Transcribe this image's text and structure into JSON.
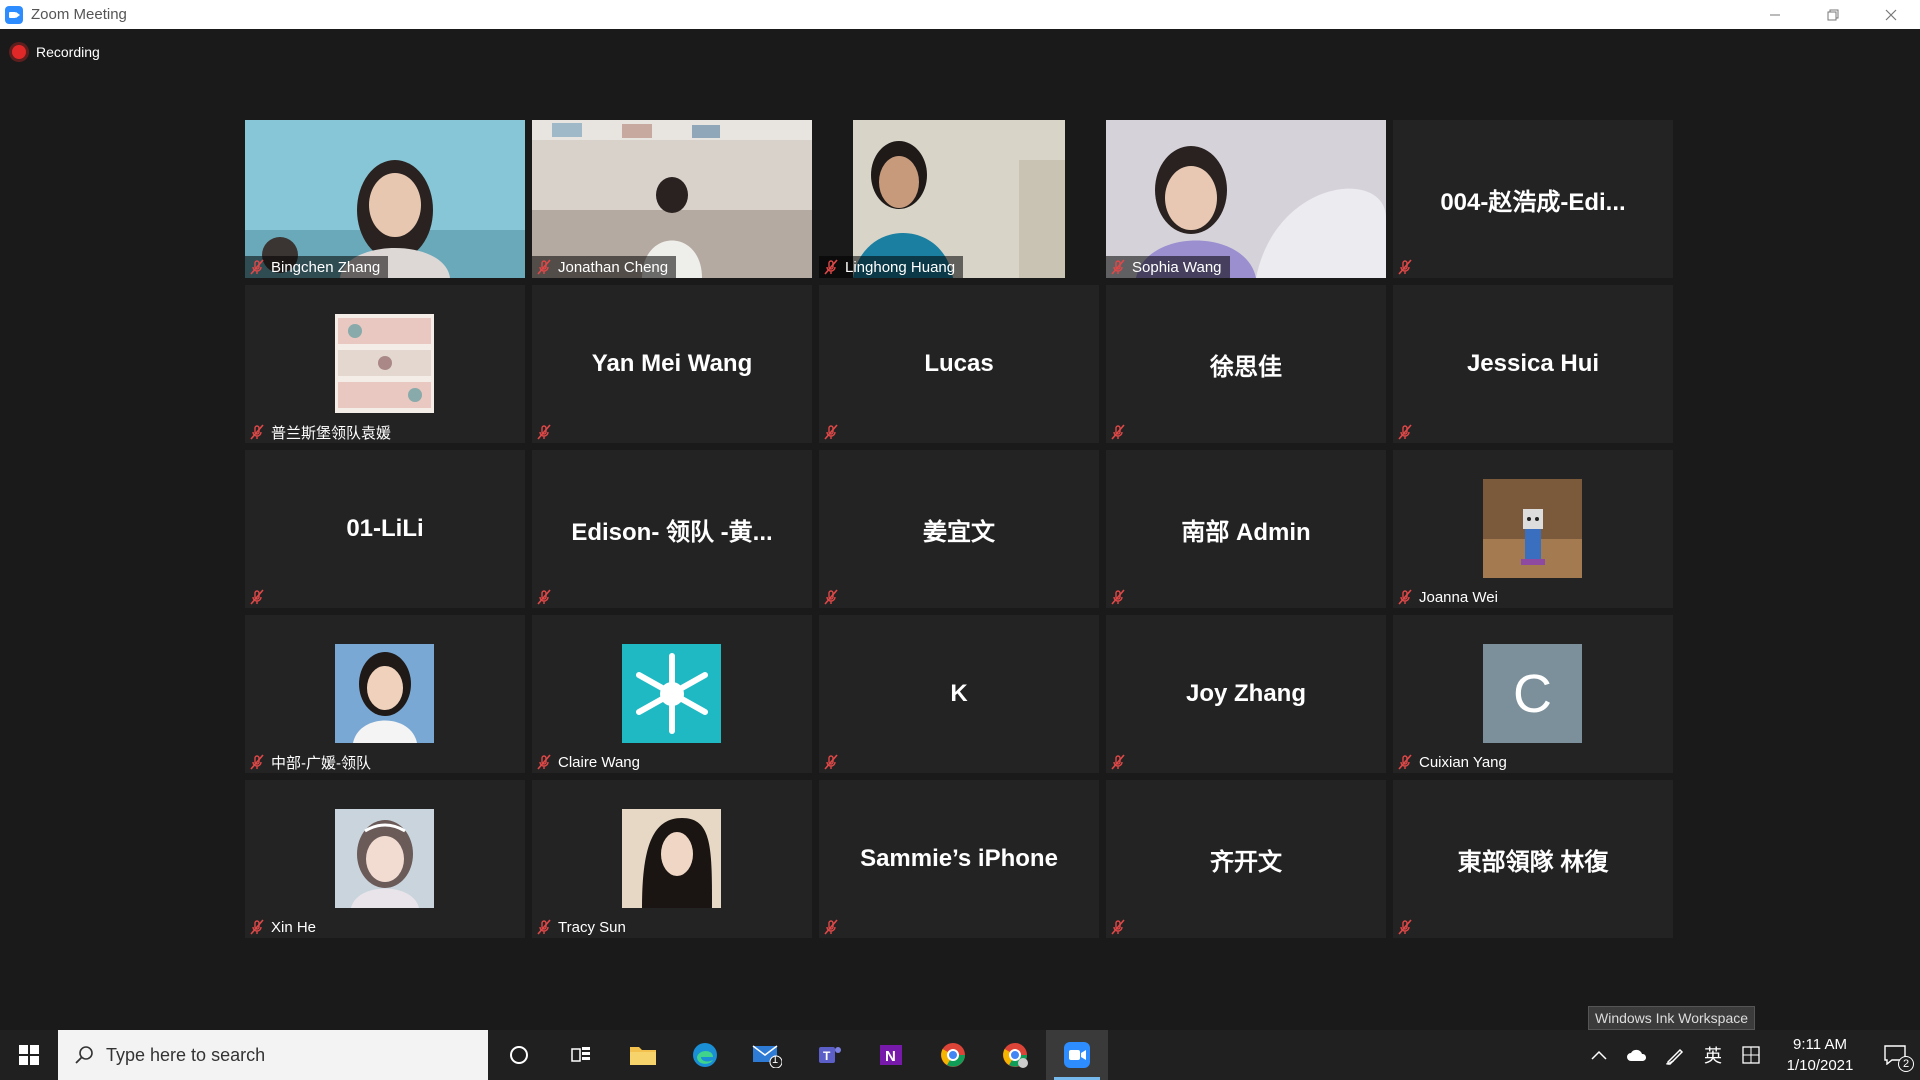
{
  "window": {
    "title": "Zoom Meeting"
  },
  "recording": {
    "label": "Recording"
  },
  "participants": [
    {
      "name": "Bingchen Zhang",
      "kind": "video"
    },
    {
      "name": "Jonathan Cheng",
      "kind": "video"
    },
    {
      "name": "Linghong Huang",
      "kind": "video"
    },
    {
      "name": "Sophia Wang",
      "kind": "video"
    },
    {
      "name": "004-赵浩成-Edi...",
      "kind": "text"
    },
    {
      "name": "普兰斯堡领队袁媛",
      "kind": "avatar",
      "avatar": "pattern"
    },
    {
      "name": "Yan Mei Wang",
      "kind": "text"
    },
    {
      "name": "Lucas",
      "kind": "text"
    },
    {
      "name": "徐思佳",
      "kind": "text"
    },
    {
      "name": "Jessica Hui",
      "kind": "text"
    },
    {
      "name": "01-LiLi",
      "kind": "text"
    },
    {
      "name": "Edison-  领队  -黄...",
      "kind": "text"
    },
    {
      "name": "姜宜文",
      "kind": "text"
    },
    {
      "name": "南部 Admin",
      "kind": "text"
    },
    {
      "name": "Joanna Wei",
      "kind": "avatar",
      "avatar": "robot"
    },
    {
      "name": "中部-广媛-领队",
      "kind": "avatar",
      "avatar": "girl-portrait"
    },
    {
      "name": "Claire Wang",
      "kind": "avatar",
      "avatar": "snowflake"
    },
    {
      "name": "K",
      "kind": "text"
    },
    {
      "name": "Joy Zhang",
      "kind": "text"
    },
    {
      "name": "Cuixian Yang",
      "kind": "avatar",
      "avatar": "letter",
      "letter": "C"
    },
    {
      "name": "Xin He",
      "kind": "avatar",
      "avatar": "girl-tiara"
    },
    {
      "name": "Tracy Sun",
      "kind": "avatar",
      "avatar": "woman-portrait"
    },
    {
      "name": "Sammie’s iPhone",
      "kind": "text"
    },
    {
      "name": "齐开文",
      "kind": "text"
    },
    {
      "name": "東部領隊 林復",
      "kind": "text"
    }
  ],
  "taskbar": {
    "search_placeholder": "Type here to search",
    "mail_badge": "1",
    "tooltip": "Windows Ink Workspace",
    "ime_label": "英",
    "time": "9:11 AM",
    "date": "1/10/2021",
    "notifications_badge": "2"
  },
  "colors": {
    "muted_mic": "#e04848",
    "zoom_blue": "#2d8cff",
    "taskbar_bg": "#202020",
    "tile_bg": "#232323"
  }
}
